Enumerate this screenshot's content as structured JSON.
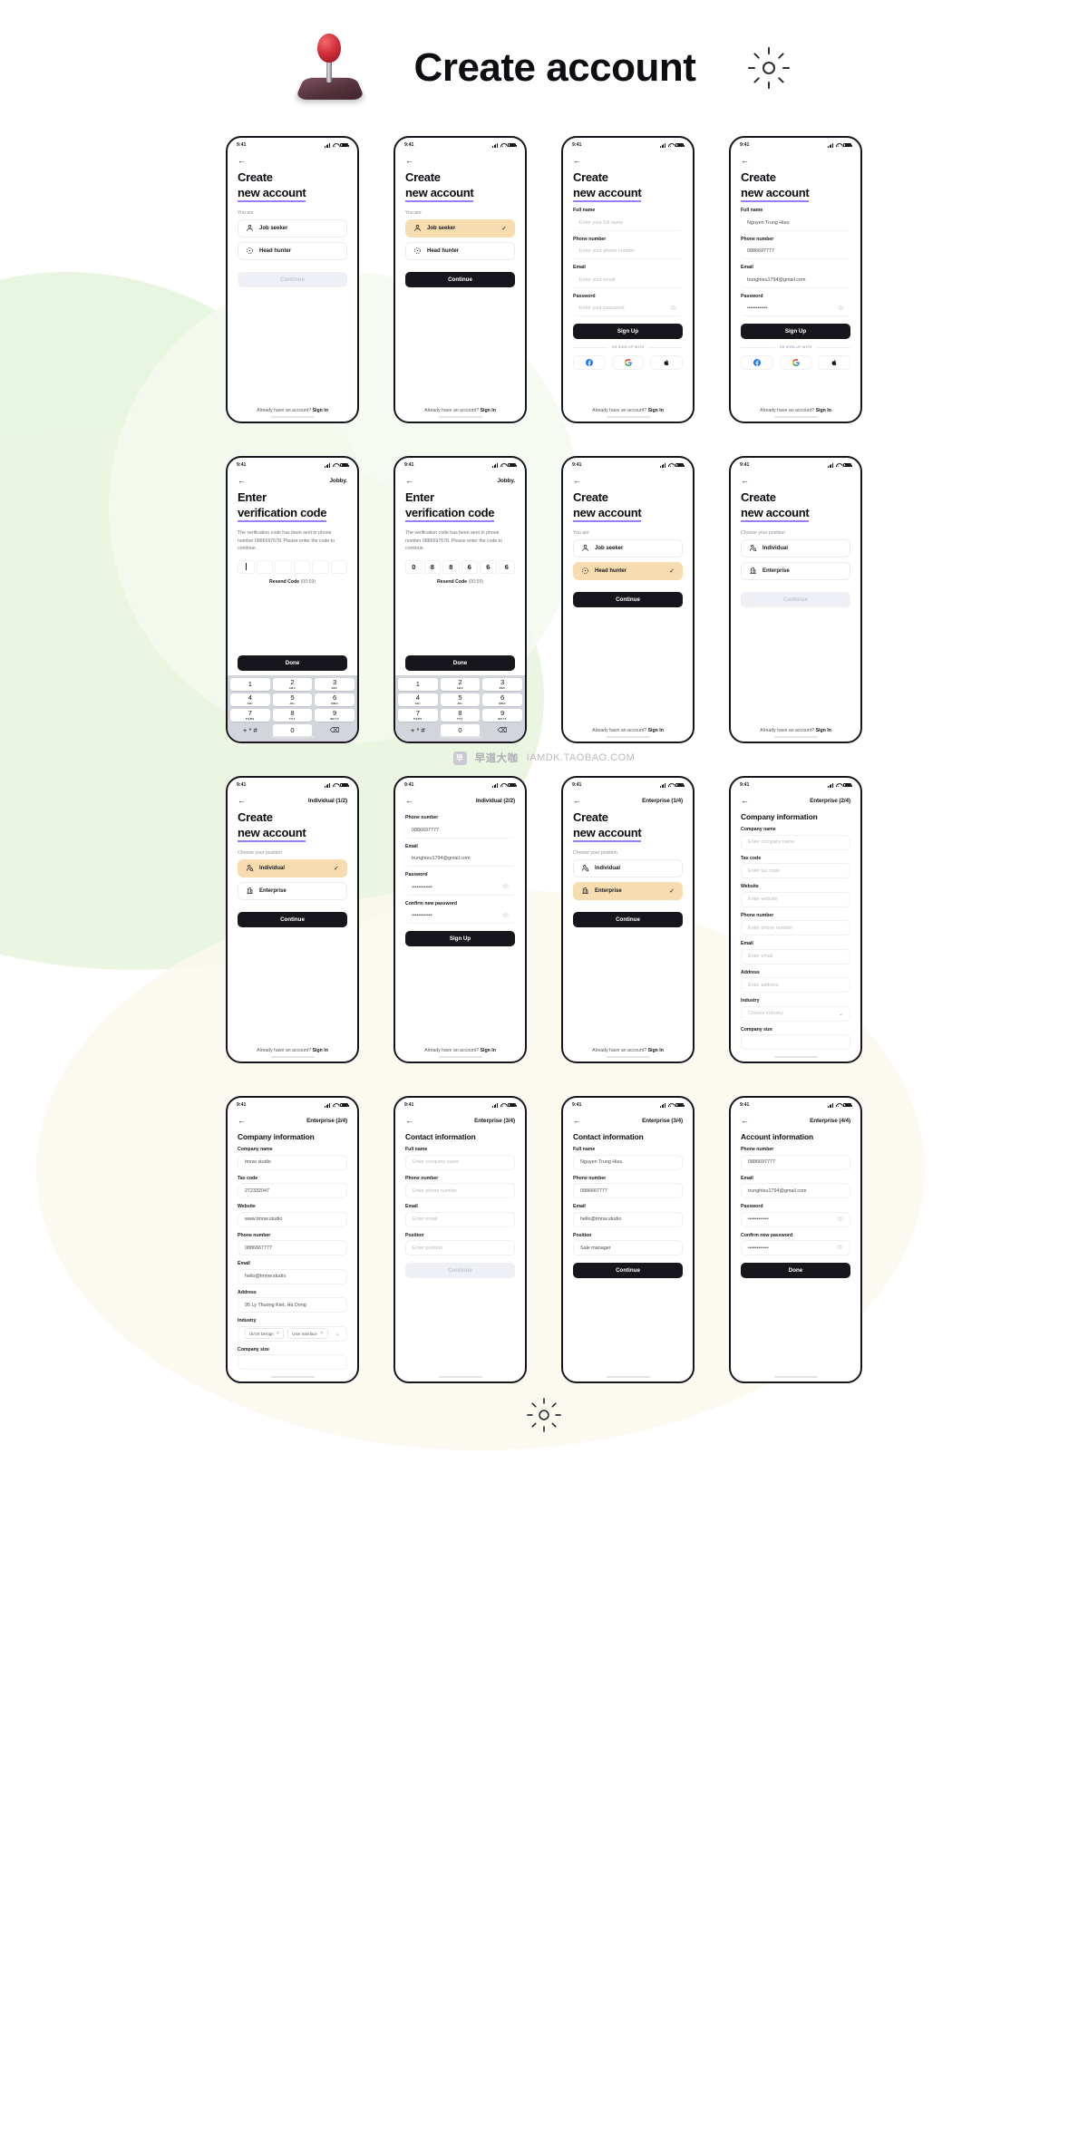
{
  "header": {
    "title": "Create account",
    "joystick_icon": "joystick-icon",
    "sun_icon": "sun-icon"
  },
  "watermark": {
    "logo_text": "早",
    "cn_text": "早道大咖",
    "url_text": "IAMDK.TAOBAO.COM"
  },
  "common": {
    "status_time": "9:41",
    "back_icon": "back-arrow-icon",
    "footer_text": "Already have an account?",
    "footer_link": "Sign In",
    "brand": "Jobby.",
    "or_sign_up": "OR SIGN UP WITH",
    "continue": "Continue",
    "sign_up": "Sign Up",
    "done": "Done",
    "you_are": "You are",
    "choose_position": "Choose your position",
    "accent_selected": "#f7dcb0",
    "accent_underline": "#9b7bff",
    "primary_dark": "#16161c",
    "disabled_bg": "#eef0f6"
  },
  "screens": [
    {
      "id": "s1",
      "title_line1": "Create",
      "title_line2": "new account",
      "section_label": "You are",
      "options": [
        {
          "label": "Job seeker",
          "icon": "user-icon",
          "selected": false
        },
        {
          "label": "Head hunter",
          "icon": "target-icon",
          "selected": false
        }
      ],
      "button": {
        "label": "Continue",
        "state": "disabled"
      }
    },
    {
      "id": "s2",
      "title_line1": "Create",
      "title_line2": "new account",
      "section_label": "You are",
      "options": [
        {
          "label": "Job seeker",
          "icon": "user-icon",
          "selected": true
        },
        {
          "label": "Head hunter",
          "icon": "target-icon",
          "selected": false
        }
      ],
      "button": {
        "label": "Continue",
        "state": "primary"
      }
    },
    {
      "id": "s3",
      "title_line1": "Create",
      "title_line2": "new account",
      "fields": [
        {
          "label": "Full name",
          "placeholder": "Enter your full name",
          "value": ""
        },
        {
          "label": "Phone number",
          "placeholder": "Enter your phone number",
          "value": ""
        },
        {
          "label": "Email",
          "placeholder": "Enter your email",
          "value": ""
        },
        {
          "label": "Password",
          "placeholder": "Enter your password",
          "value": "",
          "eye": true
        }
      ],
      "button": {
        "label": "Sign Up",
        "state": "primary"
      },
      "socials": [
        "facebook-icon",
        "google-icon",
        "apple-icon"
      ]
    },
    {
      "id": "s4",
      "title_line1": "Create",
      "title_line2": "new account",
      "fields": [
        {
          "label": "Full name",
          "placeholder": "Enter your full name",
          "value": "Nguyen Trung Hieu"
        },
        {
          "label": "Phone number",
          "placeholder": "Enter your phone number",
          "value": "0886697777"
        },
        {
          "label": "Email",
          "placeholder": "Enter your email",
          "value": "trunghieu1794@gmail.com"
        },
        {
          "label": "Password",
          "placeholder": "Enter your password",
          "value": "••••••••••••",
          "eye": true
        }
      ],
      "button": {
        "label": "Sign Up",
        "state": "primary"
      },
      "socials": [
        "facebook-icon",
        "google-icon",
        "apple-icon"
      ]
    },
    {
      "id": "s5",
      "brand": "Jobby.",
      "title_line1": "Enter",
      "title_line2": "verification code",
      "desc": "The verification code has been sent to phone number 0886697678. Please enter the code to continue.",
      "code": [
        "",
        "",
        "",
        "",
        "",
        ""
      ],
      "caret_index": 0,
      "resend_label": "Resend Code",
      "resend_timer": "(00:59)",
      "button": {
        "label": "Done",
        "state": "primary"
      },
      "keypad": [
        {
          "num": "1",
          "ltr": ""
        },
        {
          "num": "2",
          "ltr": "ABC"
        },
        {
          "num": "3",
          "ltr": "DEF"
        },
        {
          "num": "4",
          "ltr": "GHI"
        },
        {
          "num": "5",
          "ltr": "JKL"
        },
        {
          "num": "6",
          "ltr": "MNO"
        },
        {
          "num": "7",
          "ltr": "PQRS"
        },
        {
          "num": "8",
          "ltr": "TUV"
        },
        {
          "num": "9",
          "ltr": "WXYZ"
        },
        {
          "num": "+ * #",
          "ltr": "",
          "blank": true
        },
        {
          "num": "0",
          "ltr": ""
        },
        {
          "num": "⌫",
          "ltr": "",
          "del": true
        }
      ]
    },
    {
      "id": "s6",
      "brand": "Jobby.",
      "title_line1": "Enter",
      "title_line2": "verification code",
      "desc": "The verification code has been sent to phone number 0886697678. Please enter the code to continue.",
      "code": [
        "0",
        "8",
        "8",
        "6",
        "6",
        "6"
      ],
      "resend_label": "Resend Code",
      "resend_timer": "(00:59)",
      "button": {
        "label": "Done",
        "state": "primary"
      }
    },
    {
      "id": "s7",
      "title_line1": "Create",
      "title_line2": "new account",
      "section_label": "You are",
      "options": [
        {
          "label": "Job seeker",
          "icon": "user-icon",
          "selected": false
        },
        {
          "label": "Head hunter",
          "icon": "target-icon",
          "selected": true
        }
      ],
      "button": {
        "label": "Continue",
        "state": "primary"
      }
    },
    {
      "id": "s8",
      "title_line1": "Create",
      "title_line2": "new account",
      "section_label": "Choose your position",
      "options": [
        {
          "label": "Individual",
          "icon": "user-search-icon",
          "selected": false
        },
        {
          "label": "Enterprise",
          "icon": "building-icon",
          "selected": false
        }
      ],
      "button": {
        "label": "Continue",
        "state": "disabled"
      }
    },
    {
      "id": "s9",
      "step": "Individual (1/2)",
      "title_line1": "Create",
      "title_line2": "new account",
      "section_label": "Choose your position",
      "options": [
        {
          "label": "Individual",
          "icon": "user-search-icon",
          "selected": true
        },
        {
          "label": "Enterprise",
          "icon": "building-icon",
          "selected": false
        }
      ],
      "button": {
        "label": "Continue",
        "state": "primary"
      }
    },
    {
      "id": "s10",
      "step": "Individual (2/2)",
      "fields": [
        {
          "label": "Phone number",
          "placeholder": "",
          "value": "0886697777"
        },
        {
          "label": "Email",
          "placeholder": "",
          "value": "trunghieu1794@gmail.com"
        },
        {
          "label": "Password",
          "placeholder": "",
          "value": "••••••••••••",
          "eye": true
        },
        {
          "label": "Confirm new password",
          "placeholder": "",
          "value": "••••••••••••",
          "eye": true
        }
      ],
      "button": {
        "label": "Sign Up",
        "state": "primary"
      }
    },
    {
      "id": "s11",
      "step": "Enterprise (1/4)",
      "title_line1": "Create",
      "title_line2": "new account",
      "section_label": "Choose your position",
      "options": [
        {
          "label": "Individual",
          "icon": "user-search-icon",
          "selected": false
        },
        {
          "label": "Enterprise",
          "icon": "building-icon",
          "selected": true
        }
      ],
      "button": {
        "label": "Continue",
        "state": "primary"
      }
    },
    {
      "id": "s12",
      "step": "Enterprise (2/4)",
      "heading": "Company information",
      "fields": [
        {
          "label": "Company name",
          "placeholder": "Enter company name",
          "value": ""
        },
        {
          "label": "Tax code",
          "placeholder": "Enter tax code",
          "value": ""
        },
        {
          "label": "Website",
          "placeholder": "Enter website",
          "value": ""
        },
        {
          "label": "Phone number",
          "placeholder": "Enter phone number",
          "value": ""
        },
        {
          "label": "Email",
          "placeholder": "Enter email",
          "value": ""
        },
        {
          "label": "Address",
          "placeholder": "Enter address",
          "value": ""
        },
        {
          "label": "Industry",
          "placeholder": "Choose industry",
          "value": "",
          "chevron": true
        },
        {
          "label": "Company size",
          "placeholder": "",
          "value": ""
        }
      ]
    },
    {
      "id": "s13",
      "step": "Enterprise (2/4)",
      "heading": "Company information",
      "fields": [
        {
          "label": "Company name",
          "placeholder": "Enter company name",
          "value": "tmnw studio"
        },
        {
          "label": "Tax code",
          "placeholder": "Enter tax code",
          "value": "272332047"
        },
        {
          "label": "Website",
          "placeholder": "Enter website",
          "value": "www.tmnw.studio"
        },
        {
          "label": "Phone number",
          "placeholder": "Enter phone number",
          "value": "0886667777"
        },
        {
          "label": "Email",
          "placeholder": "Enter email",
          "value": "hello@tmnw.studio"
        },
        {
          "label": "Address",
          "placeholder": "Enter address",
          "value": "95 Ly Thuong Kiet, Ha Dong"
        },
        {
          "label": "Industry",
          "placeholder": "",
          "tags": [
            "UI/UX Design",
            "User Interface"
          ],
          "chevron": true
        },
        {
          "label": "Company size",
          "placeholder": "",
          "value": ""
        }
      ]
    },
    {
      "id": "s14",
      "step": "Enterprise (3/4)",
      "heading": "Contact information",
      "fields": [
        {
          "label": "Full name",
          "placeholder": "Enter company name",
          "value": ""
        },
        {
          "label": "Phone number",
          "placeholder": "Enter phone number",
          "value": ""
        },
        {
          "label": "Email",
          "placeholder": "Enter email",
          "value": ""
        },
        {
          "label": "Position",
          "placeholder": "Enter position",
          "value": ""
        }
      ],
      "button": {
        "label": "Continue",
        "state": "disabled"
      }
    },
    {
      "id": "s15",
      "step": "Enterprise (3/4)",
      "heading": "Contact information",
      "fields": [
        {
          "label": "Full name",
          "placeholder": "Enter full name",
          "value": "Nguyen Trung Hieu"
        },
        {
          "label": "Phone number",
          "placeholder": "Enter phone number",
          "value": "0886667777"
        },
        {
          "label": "Email",
          "placeholder": "Enter email",
          "value": "hello@tmnw.studio"
        },
        {
          "label": "Position",
          "placeholder": "Enter position",
          "value": "Sale manager"
        }
      ],
      "button": {
        "label": "Continue",
        "state": "primary"
      }
    },
    {
      "id": "s16",
      "step": "Enterprise (4/4)",
      "heading": "Account information",
      "fields": [
        {
          "label": "Phone number",
          "placeholder": "",
          "value": "0886697777"
        },
        {
          "label": "Email",
          "placeholder": "",
          "value": "trunghieu1794@gmail.com"
        },
        {
          "label": "Password",
          "placeholder": "",
          "value": "••••••••••••",
          "eye": true
        },
        {
          "label": "Confirm new password",
          "placeholder": "",
          "value": "••••••••••••",
          "eye": true
        }
      ],
      "button": {
        "label": "Done",
        "state": "primary"
      }
    }
  ]
}
